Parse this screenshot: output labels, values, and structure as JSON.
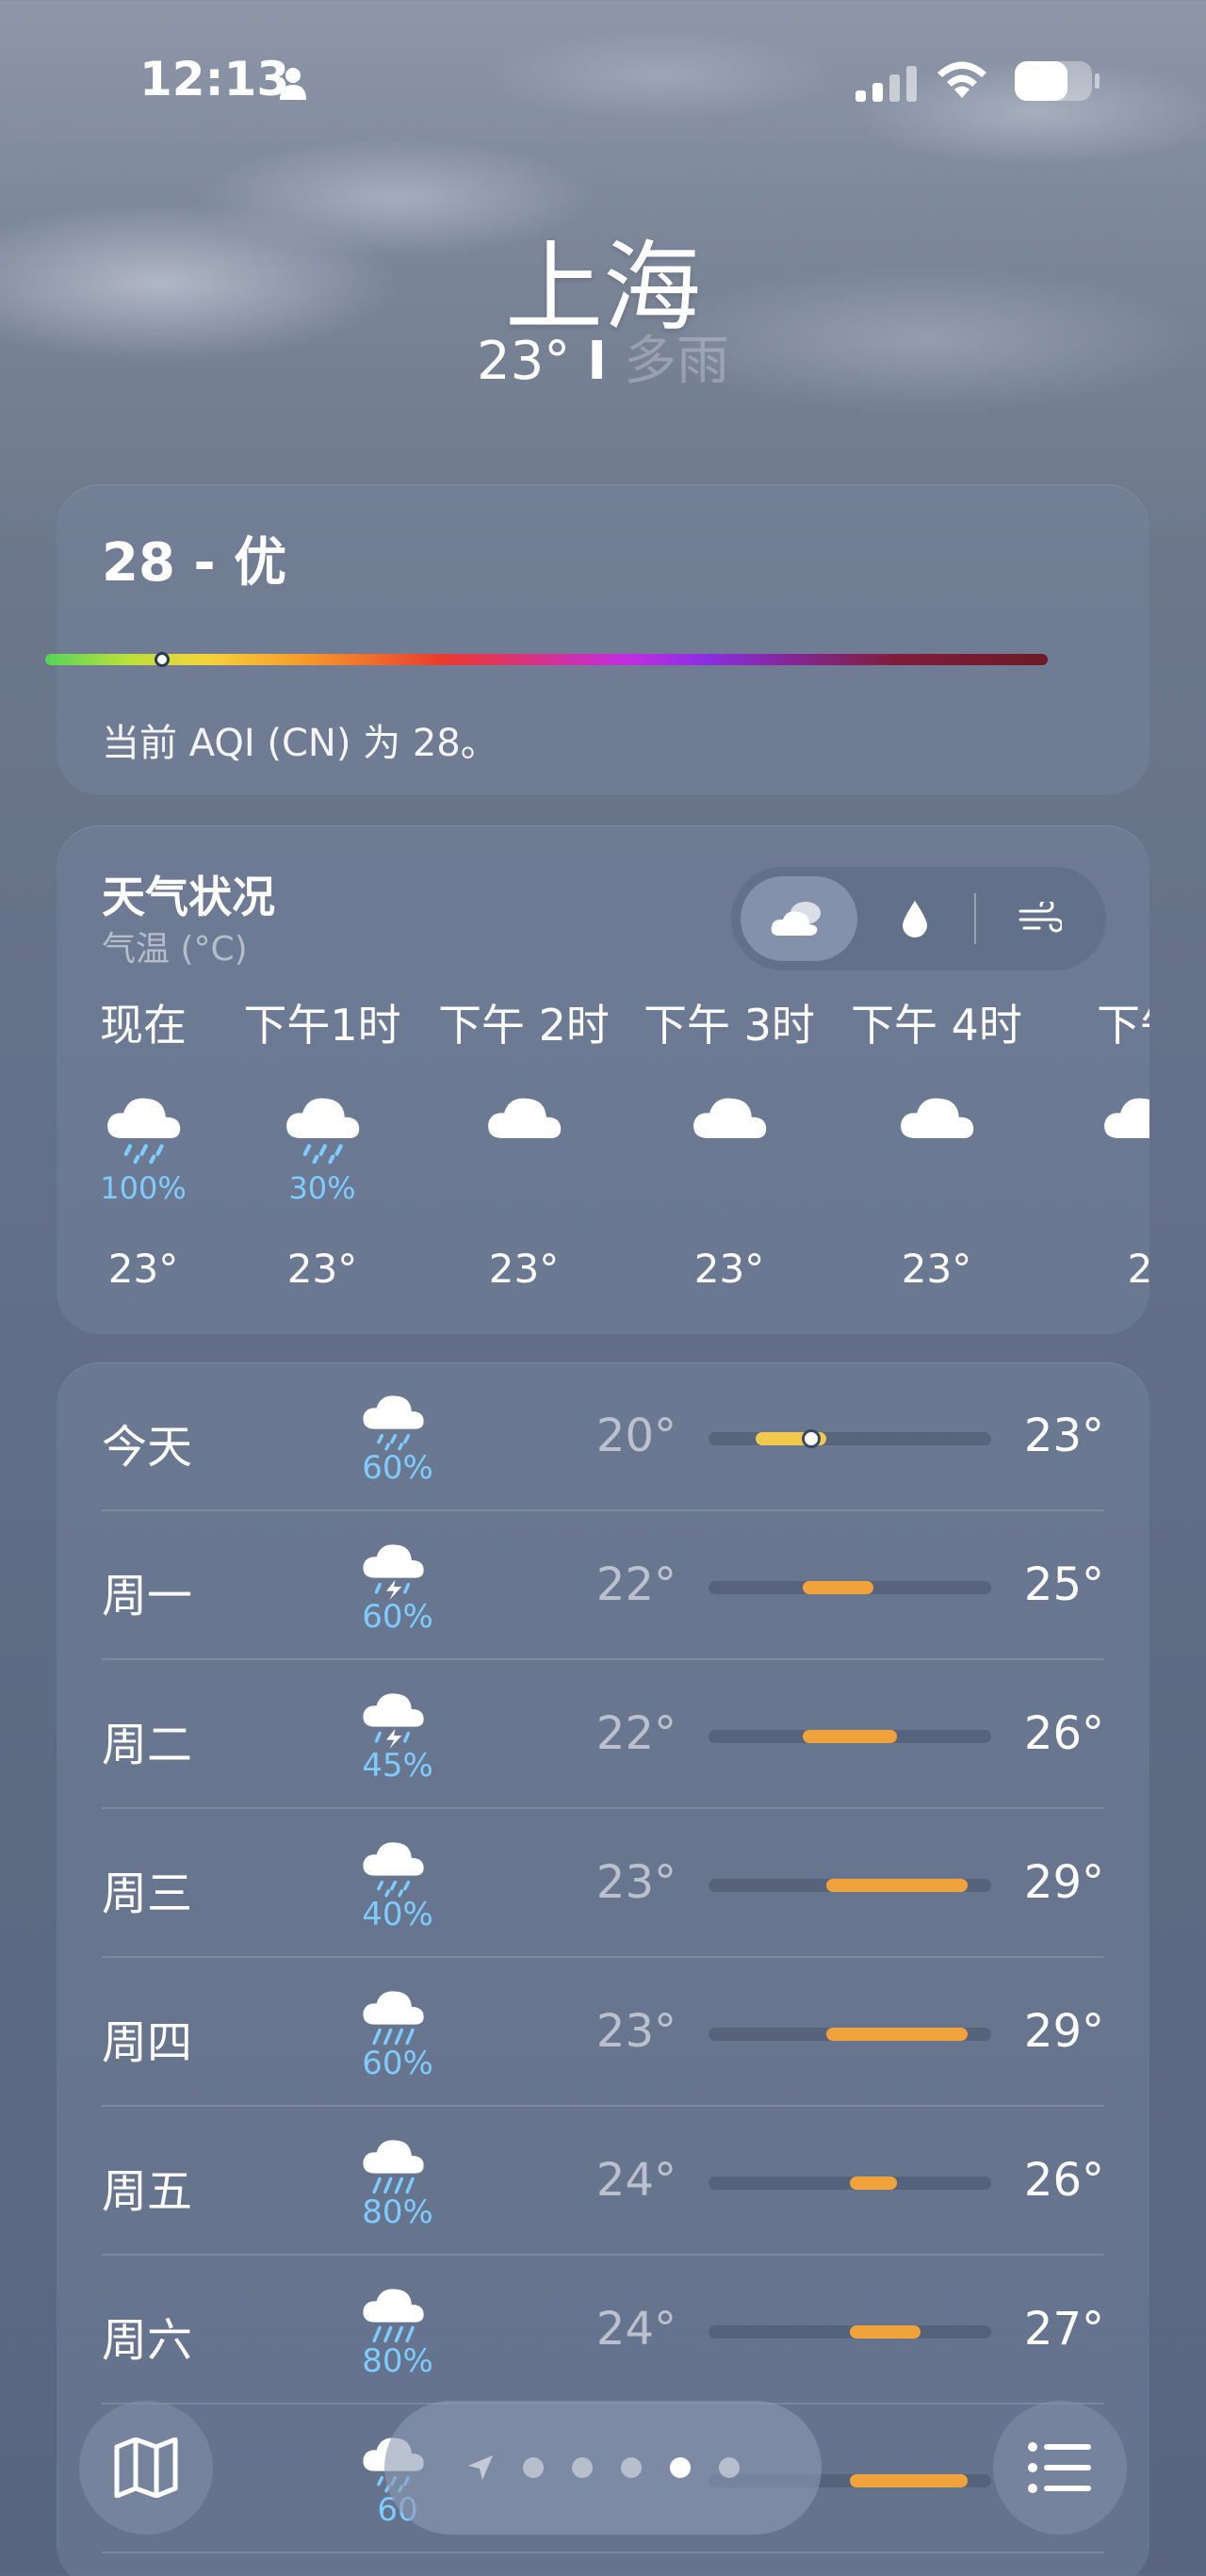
{
  "status_bar": {
    "time": "12:13"
  },
  "header": {
    "city": "上海",
    "temp": "23°",
    "separator": "I",
    "condition": "多雨"
  },
  "aqi": {
    "title": "28 - 优",
    "description": "当前 AQI (CN) 为 28。",
    "value": 28
  },
  "hourly": {
    "title": "天气状况",
    "subtitle": "气温 (°C)",
    "hours": [
      {
        "label": "现在",
        "icon": "rain-cloud-icon",
        "precip": "100%",
        "temp": "23°"
      },
      {
        "label": "下午1时",
        "icon": "rain-cloud-icon",
        "precip": "30%",
        "temp": "23°"
      },
      {
        "label": "下午 2时",
        "icon": "cloud-icon",
        "precip": "",
        "temp": "23°"
      },
      {
        "label": "下午 3时",
        "icon": "cloud-icon",
        "precip": "",
        "temp": "23°"
      },
      {
        "label": "下午 4时",
        "icon": "cloud-icon",
        "precip": "",
        "temp": "23°"
      },
      {
        "label": "下午",
        "icon": "cloud-icon",
        "precip": "",
        "temp": "2"
      }
    ]
  },
  "daily": [
    {
      "day": "今天",
      "icon": "rain-cloud-icon",
      "precip": "60%",
      "low": "20°",
      "high": "23°",
      "range": [
        20,
        23
      ],
      "current": 23
    },
    {
      "day": "周一",
      "icon": "thunderstorm-icon",
      "precip": "60%",
      "low": "22°",
      "high": "25°",
      "range": [
        22,
        25
      ]
    },
    {
      "day": "周二",
      "icon": "thunderstorm-icon",
      "precip": "45%",
      "low": "22°",
      "high": "26°",
      "range": [
        22,
        26
      ]
    },
    {
      "day": "周三",
      "icon": "rain-cloud-icon",
      "precip": "40%",
      "low": "23°",
      "high": "29°",
      "range": [
        23,
        29
      ]
    },
    {
      "day": "周四",
      "icon": "heavy-rain-icon",
      "precip": "60%",
      "low": "23°",
      "high": "29°",
      "range": [
        23,
        29
      ]
    },
    {
      "day": "周五",
      "icon": "heavy-rain-icon",
      "precip": "80%",
      "low": "24°",
      "high": "26°",
      "range": [
        24,
        26
      ]
    },
    {
      "day": "周六",
      "icon": "heavy-rain-icon",
      "precip": "80%",
      "low": "24°",
      "high": "27°",
      "range": [
        24,
        27
      ]
    },
    {
      "day": "",
      "icon": "rain-cloud-icon",
      "precip": "60",
      "low": "",
      "high": "",
      "range": [
        24,
        29
      ]
    }
  ],
  "daily_scale": [
    18,
    30
  ],
  "pager": {
    "count": 6,
    "active_index": 4
  },
  "colors": {
    "precip": "#7ecbff",
    "range_warm": "#f0a33a",
    "range_cool": "#f2c94c"
  }
}
